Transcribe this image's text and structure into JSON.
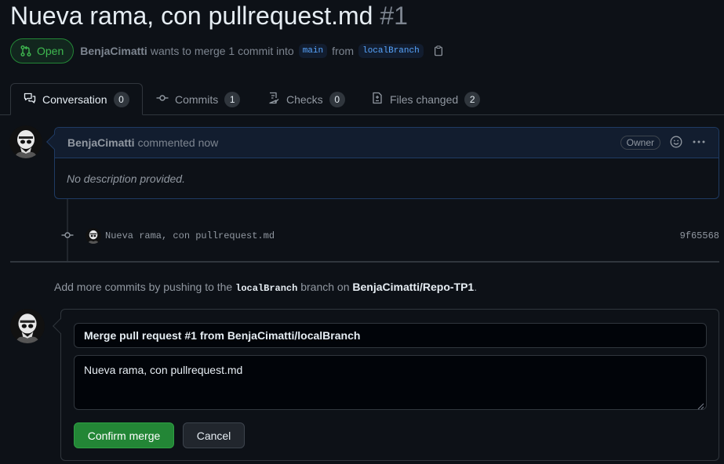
{
  "pr": {
    "title": "Nueva rama, con pullrequest.md",
    "number": "#1",
    "state": "Open",
    "author": "BenjaCimatti",
    "summary": "wants to merge 1 commit into",
    "base_branch": "main",
    "from_word": "from",
    "head_branch": "localBranch"
  },
  "tabs": [
    {
      "label": "Conversation",
      "count": "0",
      "icon": "comment-discussion-icon"
    },
    {
      "label": "Commits",
      "count": "1",
      "icon": "git-commit-icon"
    },
    {
      "label": "Checks",
      "count": "0",
      "icon": "checklist-icon"
    },
    {
      "label": "Files changed",
      "count": "2",
      "icon": "file-diff-icon"
    }
  ],
  "comment": {
    "author": "BenjaCimatti",
    "time": "commented now",
    "role": "Owner",
    "body": "No description provided."
  },
  "commit": {
    "message": "Nueva rama, con pullrequest.md",
    "sha": "9f65568"
  },
  "hint": {
    "prefix": "Add more commits by pushing to the",
    "branch": "localBranch",
    "middle": "branch on",
    "repo": "BenjaCimatti/Repo-TP1",
    "suffix": "."
  },
  "merge": {
    "title_value": "Merge pull request #1 from BenjaCimatti/localBranch",
    "body_value": "Nueva rama, con pullrequest.md",
    "confirm_label": "Confirm merge",
    "cancel_label": "Cancel"
  },
  "colors": {
    "background": "#0d1117",
    "open_green": "#3fb950",
    "link_blue": "#58a6ff",
    "confirm_green": "#238636"
  }
}
